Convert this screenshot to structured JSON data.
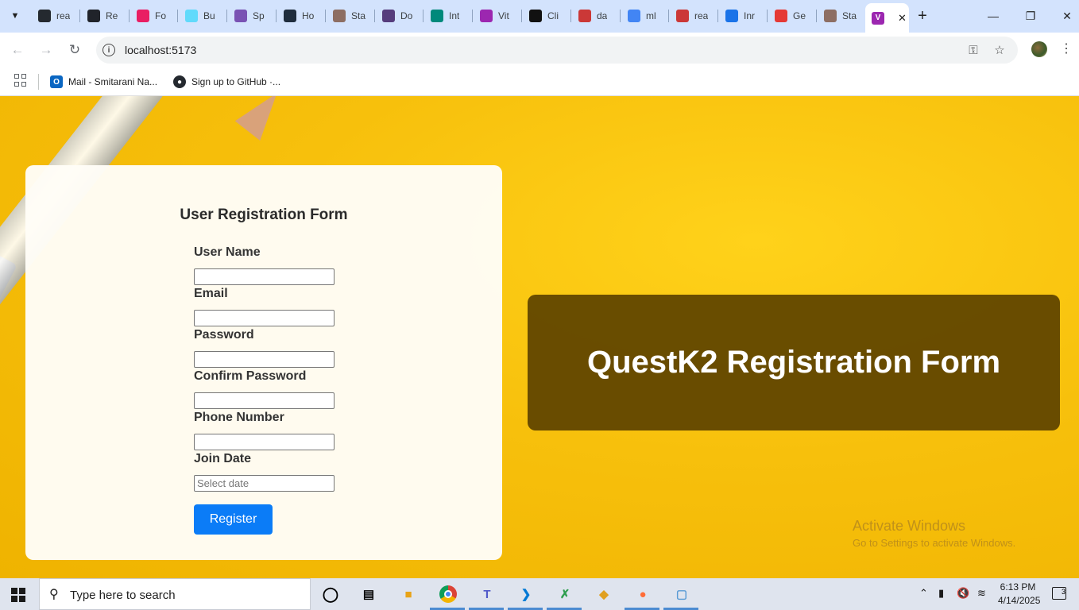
{
  "browser": {
    "tabs": [
      {
        "title": "rea",
        "icon": "github-icon",
        "color": "#24292f"
      },
      {
        "title": "Re",
        "icon": "react-icon",
        "color": "#20232a"
      },
      {
        "title": "Fo",
        "icon": "framer-icon",
        "color": "#e91e63"
      },
      {
        "title": "Bu",
        "icon": "react-icon",
        "color": "#61dafb"
      },
      {
        "title": "Sp",
        "icon": "bootstrap-icon",
        "color": "#7952b3"
      },
      {
        "title": "Ho",
        "icon": "ant-icon",
        "color": "#1f2d3d"
      },
      {
        "title": "Sta",
        "icon": "stackblitz-icon",
        "color": "#8d6e63"
      },
      {
        "title": "Do",
        "icon": "bootstrap-icon",
        "color": "#563d7c"
      },
      {
        "title": "Int",
        "icon": "react-icon",
        "color": "#00897b"
      },
      {
        "title": "Vit",
        "icon": "vite-icon",
        "color": "#9c27b0"
      },
      {
        "title": "Cli",
        "icon": "mui-icon",
        "color": "#111111"
      },
      {
        "title": "da",
        "icon": "npm-icon",
        "color": "#cb3837"
      },
      {
        "title": "ml",
        "icon": "google-icon",
        "color": "#4285f4"
      },
      {
        "title": "rea",
        "icon": "npm-icon",
        "color": "#cb3837"
      },
      {
        "title": "Inr",
        "icon": "search-icon",
        "color": "#1a73e8"
      },
      {
        "title": "Ge",
        "icon": "java-icon",
        "color": "#e53935"
      },
      {
        "title": "Sta",
        "icon": "stackblitz-icon",
        "color": "#8d6e63"
      }
    ],
    "active_tab_icon": "vite-icon",
    "url": "localhost:5173",
    "bookmarks": [
      {
        "label": "Mail - Smitarani Na...",
        "icon": "outlook-icon",
        "color": "#0a66c2"
      },
      {
        "label": "Sign up to GitHub ·...",
        "icon": "github-icon",
        "color": "#24292f"
      }
    ]
  },
  "form": {
    "title": "User Registration Form",
    "fields": [
      {
        "label": "User Name",
        "value": "",
        "placeholder": ""
      },
      {
        "label": "Email",
        "value": "",
        "placeholder": ""
      },
      {
        "label": "Password",
        "value": "",
        "placeholder": ""
      },
      {
        "label": "Confirm Password",
        "value": "",
        "placeholder": ""
      },
      {
        "label": "Phone Number",
        "value": "",
        "placeholder": ""
      },
      {
        "label": "Join Date",
        "value": "",
        "placeholder": "Select date"
      }
    ],
    "submit_label": "Register"
  },
  "banner": {
    "title": "QuestK2 Registration Form"
  },
  "watermark": {
    "line1": "Activate Windows",
    "line2": "Go to Settings to activate Windows."
  },
  "taskbar": {
    "search_placeholder": "Type here to search",
    "time": "6:13 PM",
    "date": "4/14/2025",
    "notification_count": "3"
  }
}
